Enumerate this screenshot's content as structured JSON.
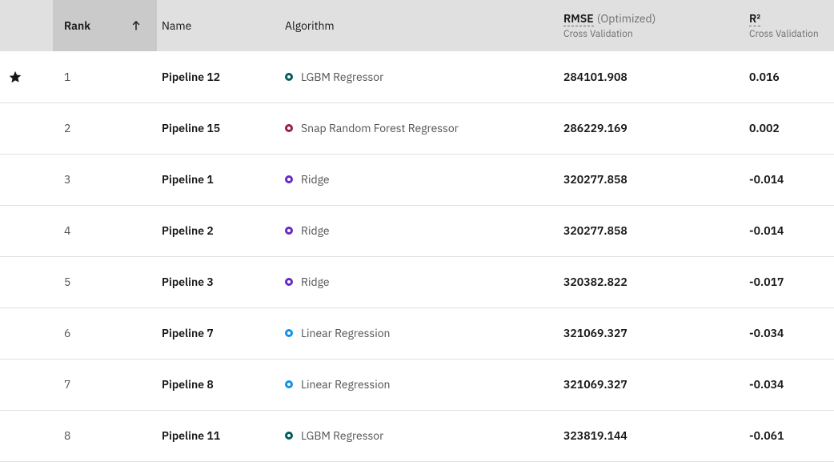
{
  "headers": {
    "rank": "Rank",
    "name": "Name",
    "algorithm": "Algorithm",
    "rmse_abbr": "RMSE",
    "rmse_opt": "(Optimized)",
    "rmse_sub": "Cross Validation",
    "r2_abbr": "R²",
    "r2_sub": "Cross Validation"
  },
  "algorithm_colors": {
    "lgbm": "#005d5d",
    "snap_rf": "#9f1853",
    "ridge": "#6929c4",
    "linear": "#1192e8"
  },
  "rows": [
    {
      "starred": true,
      "rank": "1",
      "name": "Pipeline 12",
      "algorithm": "LGBM Regressor",
      "algo_key": "lgbm",
      "rmse": "284101.908",
      "r2": "0.016"
    },
    {
      "starred": false,
      "rank": "2",
      "name": "Pipeline 15",
      "algorithm": "Snap Random Forest Regressor",
      "algo_key": "snap_rf",
      "rmse": "286229.169",
      "r2": "0.002"
    },
    {
      "starred": false,
      "rank": "3",
      "name": "Pipeline 1",
      "algorithm": "Ridge",
      "algo_key": "ridge",
      "rmse": "320277.858",
      "r2": "-0.014"
    },
    {
      "starred": false,
      "rank": "4",
      "name": "Pipeline 2",
      "algorithm": "Ridge",
      "algo_key": "ridge",
      "rmse": "320277.858",
      "r2": "-0.014"
    },
    {
      "starred": false,
      "rank": "5",
      "name": "Pipeline 3",
      "algorithm": "Ridge",
      "algo_key": "ridge",
      "rmse": "320382.822",
      "r2": "-0.017"
    },
    {
      "starred": false,
      "rank": "6",
      "name": "Pipeline 7",
      "algorithm": "Linear Regression",
      "algo_key": "linear",
      "rmse": "321069.327",
      "r2": "-0.034"
    },
    {
      "starred": false,
      "rank": "7",
      "name": "Pipeline 8",
      "algorithm": "Linear Regression",
      "algo_key": "linear",
      "rmse": "321069.327",
      "r2": "-0.034"
    },
    {
      "starred": false,
      "rank": "8",
      "name": "Pipeline 11",
      "algorithm": "LGBM Regressor",
      "algo_key": "lgbm",
      "rmse": "323819.144",
      "r2": "-0.061"
    }
  ]
}
